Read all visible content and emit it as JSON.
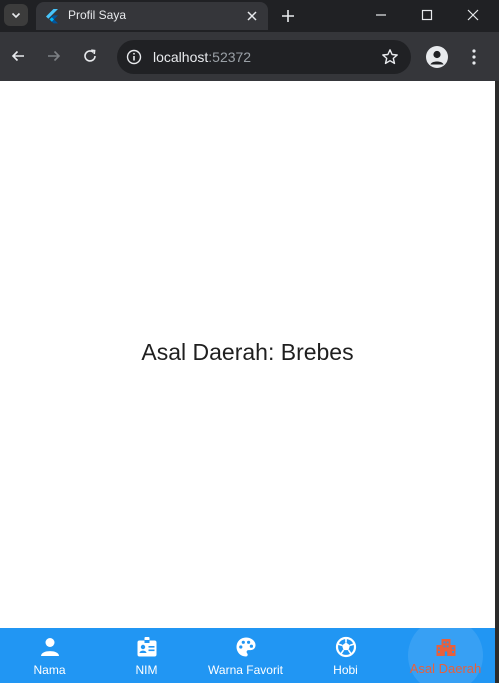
{
  "browser": {
    "tab_title": "Profil Saya",
    "url_host": "localhost",
    "url_port": ":52372",
    "icons": {
      "tab_search": "chevron-down-icon",
      "favicon": "flutter-logo",
      "tab_close": "close-icon",
      "new_tab": "plus-icon",
      "minimize": "minimize-icon",
      "maximize": "maximize-icon",
      "close_window": "close-icon",
      "back": "arrow-left-icon",
      "forward": "arrow-right-icon",
      "reload": "reload-icon",
      "site_info": "info-icon",
      "bookmark": "star-icon",
      "profile": "person-icon",
      "menu": "kebab-menu-icon"
    }
  },
  "page": {
    "main_text": "Asal Daerah: Brebes"
  },
  "bottom_nav": {
    "items": [
      {
        "label": "Nama",
        "icon": "person-icon"
      },
      {
        "label": "NIM",
        "icon": "badge-icon"
      },
      {
        "label": "Warna Favorit",
        "icon": "palette-icon"
      },
      {
        "label": "Hobi",
        "icon": "soccer-ball-icon"
      },
      {
        "label": "Asal Daerah",
        "icon": "building-icon"
      }
    ],
    "selected": "Asal Daerah"
  },
  "colors": {
    "nav_background": "#2196f3",
    "nav_selected": "#e8603c",
    "nav_unselected": "#ffffff",
    "browser_frame": "#202124",
    "browser_toolbar": "#35363a"
  }
}
